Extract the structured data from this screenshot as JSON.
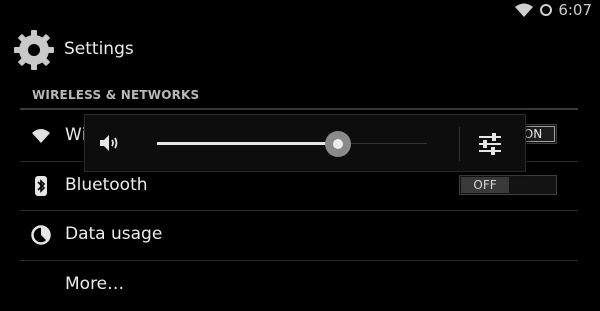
{
  "status_bar": {
    "time": "6:07",
    "icons": [
      "wifi-icon",
      "sync-icon"
    ]
  },
  "action_bar": {
    "title": "Settings",
    "icon": "settings-gear-icon"
  },
  "section": {
    "header": "WIRELESS & NETWORKS"
  },
  "rows": [
    {
      "label": "Wi-Fi",
      "icon": "wifi-icon",
      "toggle_on": "ON"
    },
    {
      "label": "Bluetooth",
      "icon": "bluetooth-icon",
      "toggle_off": "OFF"
    },
    {
      "label": "Data usage",
      "icon": "data-usage-icon"
    },
    {
      "label": "More…"
    }
  ],
  "volume_panel": {
    "level": 0.67,
    "icons": [
      "speaker-icon",
      "equalizer-icon"
    ]
  },
  "colors": {
    "background": "#000000",
    "text": "#ececec",
    "section_header": "#b7b7b7"
  }
}
